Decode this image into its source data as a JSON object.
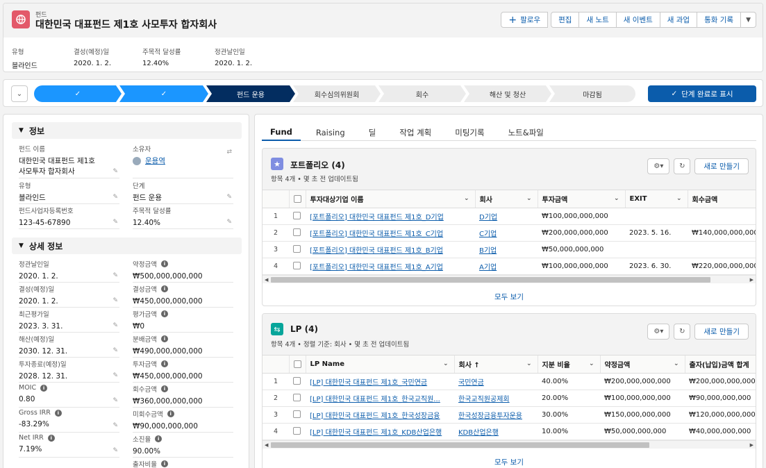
{
  "header": {
    "object_type": "펀드",
    "title": "대한민국 대표펀드 제1호 사모투자 합자회사",
    "follow_label": "팔로우",
    "actions": [
      "편집",
      "새 노트",
      "새 이벤트",
      "새 과업",
      "통화 기록"
    ],
    "highlights": [
      {
        "label": "유형",
        "value": "블라인드"
      },
      {
        "label": "결성(예정)일",
        "value": "2020. 1. 2."
      },
      {
        "label": "주목적 달성률",
        "value": "12.40%"
      },
      {
        "label": "정관날인일",
        "value": "2020. 1. 2."
      }
    ]
  },
  "path": {
    "stages": [
      "",
      "",
      "펀드 운용",
      "회수심의위원회",
      "회수",
      "해산 및 청산",
      "마감됨"
    ],
    "complete_label": "단계 완료로 표시"
  },
  "left": {
    "info_title": "정보",
    "info_fields": [
      {
        "label": "펀드 이름",
        "value": "대한민국 대표펀드 제1호 사모투자 합자회사"
      },
      {
        "label": "소유자",
        "value": "운용역"
      },
      {
        "label": "유형",
        "value": "블라인드"
      },
      {
        "label": "단계",
        "value": "펀드 운용"
      },
      {
        "label": "펀드사업자등록번호",
        "value": "123-45-67890"
      },
      {
        "label": "주목적 달성률",
        "value": "12.40%"
      }
    ],
    "detail_title": "상세 정보",
    "detail_fields": [
      {
        "label": "정관날인일",
        "value": "2020. 1. 2."
      },
      {
        "label": "약정금액",
        "value": "₩500,000,000,000"
      },
      {
        "label": "결성(예정)일",
        "value": "2020. 1. 2."
      },
      {
        "label": "결성금액",
        "value": "₩450,000,000,000"
      },
      {
        "label": "최근평가일",
        "value": "2023. 3. 31."
      },
      {
        "label": "평가금액",
        "value": "₩0"
      },
      {
        "label": "해산(예정)일",
        "value": "2030. 12. 31."
      },
      {
        "label": "분배금액",
        "value": "₩490,000,000,000"
      },
      {
        "label": "투자종료(예정)일",
        "value": "2028. 12. 31."
      },
      {
        "label": "투자금액",
        "value": "₩450,000,000,000"
      },
      {
        "label": "MOIC",
        "value": "0.80"
      },
      {
        "label": "회수금액",
        "value": "₩360,000,000,000"
      },
      {
        "label": "Gross IRR",
        "value": "-83.29%"
      },
      {
        "label": "미회수금액",
        "value": "₩90,000,000,000"
      },
      {
        "label": "Net IRR",
        "value": "7.19%"
      },
      {
        "label": "소진율",
        "value": "90.00%"
      },
      {
        "label": "",
        "value": ""
      },
      {
        "label": "출자비율",
        "value": ""
      }
    ]
  },
  "tabs": [
    "Fund",
    "Raising",
    "딜",
    "작업 계획",
    "미팅기록",
    "노트&파일"
  ],
  "portfolio": {
    "title": "포트폴리오 (4)",
    "subtitle": "항목 4개 • 몇 초 전 업데이트됨",
    "new_label": "새로 만들기",
    "columns": [
      "투자대상기업 이름",
      "회사",
      "투자금액",
      "EXIT",
      "회수금액"
    ],
    "rows": [
      {
        "n": "1",
        "name": "[포트폴리오] 대한민국 대표펀드 제1호_D기업",
        "company": "D기업",
        "amount": "₩100,000,000,000",
        "exit": "",
        "recovered": ""
      },
      {
        "n": "2",
        "name": "[포트폴리오] 대한민국 대표펀드 제1호_C기업",
        "company": "C기업",
        "amount": "₩200,000,000,000",
        "exit": "2023. 5. 16.",
        "recovered": "₩140,000,000,000"
      },
      {
        "n": "3",
        "name": "[포트폴리오] 대한민국 대표펀드 제1호_B기업",
        "company": "B기업",
        "amount": "₩50,000,000,000",
        "exit": "",
        "recovered": ""
      },
      {
        "n": "4",
        "name": "[포트폴리오] 대한민국 대표펀드 제1호_A기업",
        "company": "A기업",
        "amount": "₩100,000,000,000",
        "exit": "2023. 6. 30.",
        "recovered": "₩220,000,000,000"
      }
    ],
    "view_all": "모두 보기"
  },
  "lp": {
    "title": "LP (4)",
    "subtitle": "항목 4개 • 정렬 기준: 회사 • 몇 초 전 업데이트됨",
    "new_label": "새로 만들기",
    "columns": [
      "LP Name",
      "회사 ↑",
      "지분 비율",
      "약정금액",
      "출자(납입)금액 합계"
    ],
    "rows": [
      {
        "n": "1",
        "name": "[LP] 대한민국 대표펀드 제1호_국민연금",
        "company": "국민연금",
        "ratio": "40.00%",
        "commit": "₩200,000,000,000",
        "paid": "₩200,000,000,000"
      },
      {
        "n": "2",
        "name": "[LP] 대한민국 대표펀드 제1호_한국교직원...",
        "company": "한국교직원공제회",
        "ratio": "20.00%",
        "commit": "₩100,000,000,000",
        "paid": "₩90,000,000,000"
      },
      {
        "n": "3",
        "name": "[LP] 대한민국 대표펀드 제1호_한국성장금융",
        "company": "한국성장금융투자운용",
        "ratio": "30.00%",
        "commit": "₩150,000,000,000",
        "paid": "₩120,000,000,000"
      },
      {
        "n": "4",
        "name": "[LP] 대한민국 대표펀드 제1호_KDB산업은행",
        "company": "KDB산업은행",
        "ratio": "10.00%",
        "commit": "₩50,000,000,000",
        "paid": "₩40,000,000,000"
      }
    ],
    "view_all": "모두 보기"
  },
  "colors": {
    "brand": "#0b5cab",
    "path_done": "#1b96ff",
    "path_current": "#032d60",
    "fund_icon": "#e3596a",
    "portfolio_icon": "#7f8de1",
    "lp_icon": "#06a59a"
  }
}
